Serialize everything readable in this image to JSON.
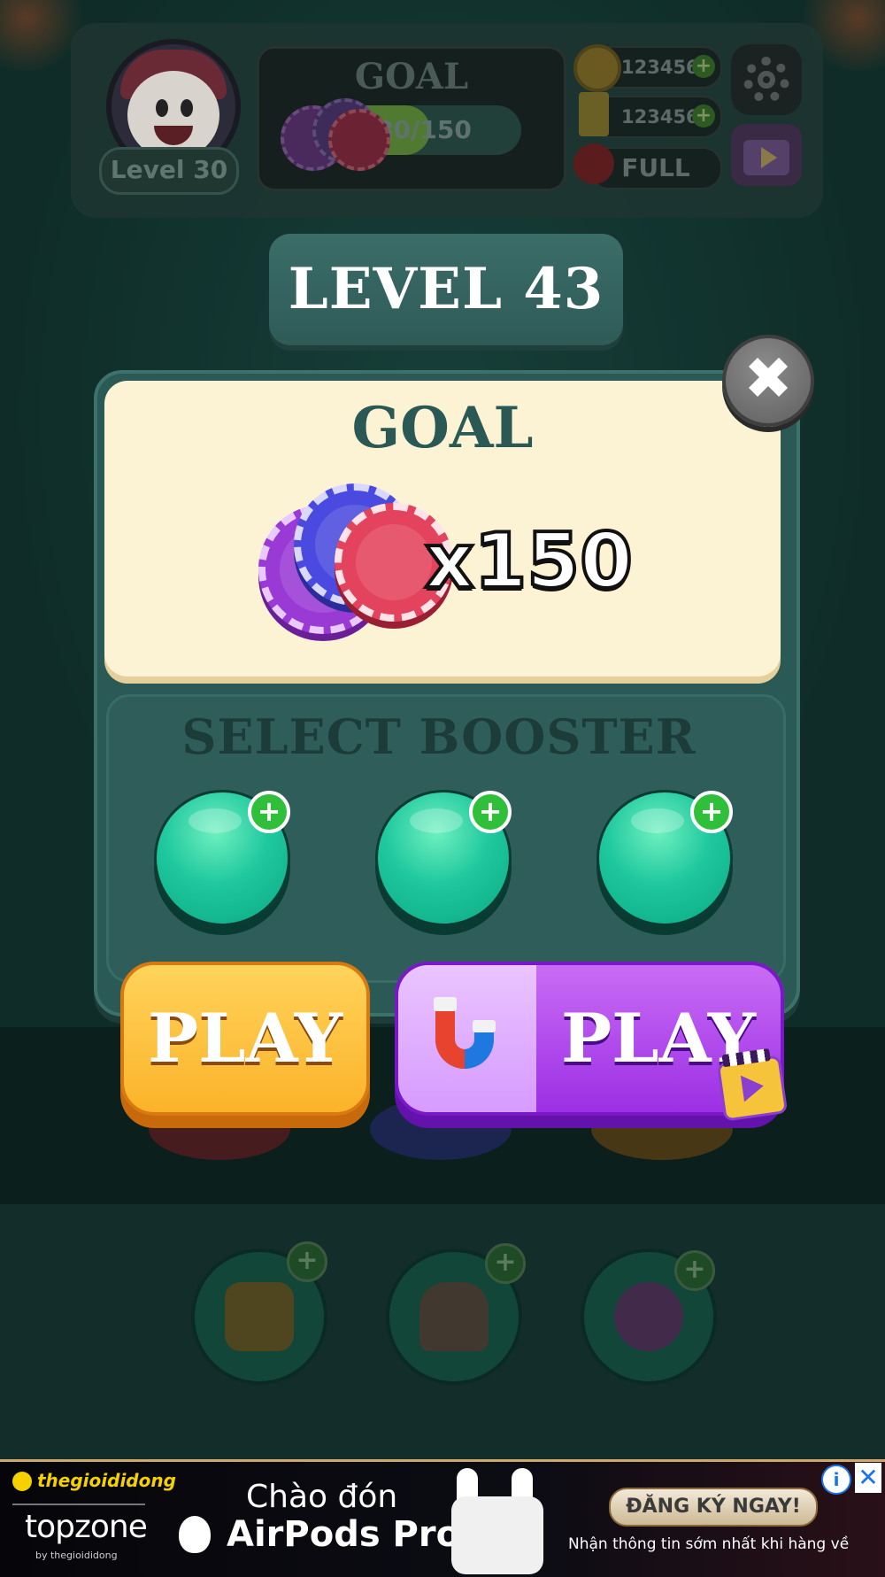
{
  "hud": {
    "player_level": "Level 30",
    "goal_title": "GOAL",
    "goal_progress_text": "80/150",
    "goal_progress_fraction": 0.53,
    "coins": "123456",
    "tickets": "123456",
    "lives": "FULL",
    "plus": "+",
    "icons": [
      "gear-icon",
      "video-ad-icon",
      "coin-icon",
      "ticket-icon",
      "heart-icon"
    ]
  },
  "level_banner": "LEVEL 43",
  "popup": {
    "close_symbol": "✖",
    "goal_title": "GOAL",
    "goal_amount": "x150",
    "booster_title": "SELECT BOOSTER",
    "booster_plus": "+",
    "play_label": "PLAY",
    "play_ad_label": "PLAY"
  },
  "booster_bar": {
    "plus": "+",
    "items": [
      "hammer-icon",
      "hand-icon",
      "swap-arrows-icon"
    ]
  },
  "ad": {
    "brand_top": "thegioididong",
    "brand_main": "topzone",
    "brand_by": "by thegioididong",
    "headline_1": "Chào đón",
    "headline_2": "AirPods Pro 2",
    "cta": "ĐĂNG KÝ NGAY!",
    "subtext": "Nhận thông tin sớm nhất khi hàng về",
    "info": "i",
    "close": "✕"
  },
  "colors": {
    "background": "#0f2c28",
    "panel": "#2b5a56",
    "goal_card": "#fcf3d5",
    "play_orange": "#fbb32a",
    "play_purple": "#9c2fe4",
    "booster_green": "#1fc89e"
  }
}
